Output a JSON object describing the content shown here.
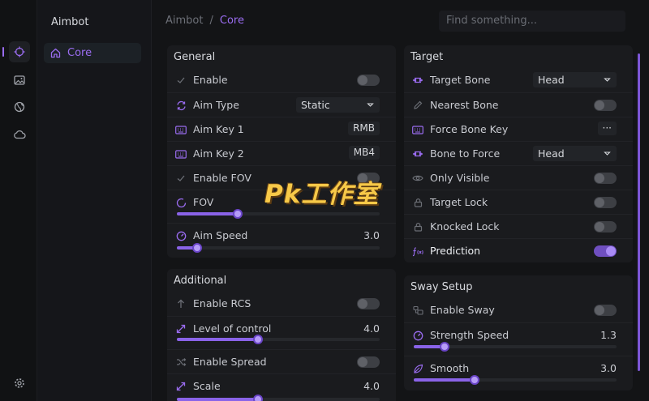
{
  "rail": {
    "icons": [
      "crosshair-icon",
      "image-icon",
      "globe-icon",
      "cloud-icon",
      "settings-icon"
    ]
  },
  "nav": {
    "title": "Aimbot",
    "items": [
      {
        "label": "Core",
        "icon": "home-icon"
      }
    ]
  },
  "header": {
    "breadcrumb": [
      "Aimbot",
      "Core"
    ],
    "separator": "/",
    "search_placeholder": "Find something..."
  },
  "colors": {
    "accent": "#9a6cf0",
    "background": "#131416",
    "card": "#1a1b1e"
  },
  "general": {
    "title": "General",
    "enable": {
      "label": "Enable",
      "on": false
    },
    "aim_type": {
      "label": "Aim Type",
      "value": "Static"
    },
    "aim_key_1": {
      "label": "Aim Key 1",
      "value": "RMB"
    },
    "aim_key_2": {
      "label": "Aim Key 2",
      "value": "MB4"
    },
    "enable_fov": {
      "label": "Enable FOV",
      "on": false
    },
    "fov": {
      "label": "FOV",
      "fraction": 0.3
    },
    "aim_speed": {
      "label": "Aim Speed",
      "value": "3.0",
      "fraction": 0.1
    }
  },
  "additional": {
    "title": "Additional",
    "enable_rcs": {
      "label": "Enable RCS",
      "on": false
    },
    "level_of_control": {
      "label": "Level of control",
      "value": "4.0",
      "fraction": 0.4
    },
    "enable_spread": {
      "label": "Enable Spread",
      "on": false
    },
    "scale": {
      "label": "Scale",
      "value": "4.0",
      "fraction": 0.4
    }
  },
  "target": {
    "title": "Target",
    "target_bone": {
      "label": "Target Bone",
      "value": "Head"
    },
    "nearest_bone": {
      "label": "Nearest Bone",
      "on": false
    },
    "force_bone_key": {
      "label": "Force Bone Key",
      "value": "···"
    },
    "bone_to_force": {
      "label": "Bone to Force",
      "value": "Head"
    },
    "only_visible": {
      "label": "Only Visible",
      "on": false
    },
    "target_lock": {
      "label": "Target Lock",
      "on": false
    },
    "knocked_lock": {
      "label": "Knocked Lock",
      "on": false
    },
    "prediction": {
      "label": "Prediction",
      "on": true
    }
  },
  "sway": {
    "title": "Sway Setup",
    "enable_sway": {
      "label": "Enable Sway",
      "on": false
    },
    "strength_speed": {
      "label": "Strength Speed",
      "value": "1.3",
      "fraction": 0.15
    },
    "smooth": {
      "label": "Smooth",
      "value": "3.0",
      "fraction": 0.3
    }
  },
  "watermark": "Pk工作室"
}
